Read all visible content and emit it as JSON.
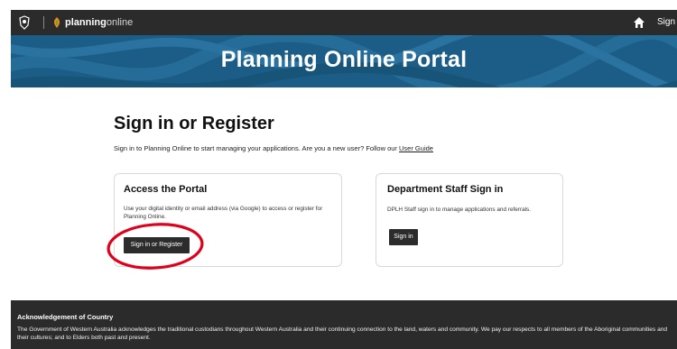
{
  "topbar": {
    "brand_bold": "planning",
    "brand_light": "online",
    "signin_link": "Sign i",
    "icons": [
      "crest-icon",
      "planning-logo-icon",
      "home-icon"
    ]
  },
  "hero": {
    "title": "Planning Online Portal",
    "background": "#1b5d86"
  },
  "main": {
    "title": "Sign in or Register",
    "intro": "Sign in to Planning Online to start managing your applications. Are you a new user? Follow our ",
    "user_guide_link": "User Guide"
  },
  "cards": [
    {
      "title": "Access the Portal",
      "description": "Use your digital identity or email address (via Google) to access or register for Planning Online.",
      "button_label": "Sign in or Register"
    },
    {
      "title": "Department Staff Sign in",
      "description": "DPLH Staff sign in to manage applications and referrals.",
      "button_label": "Sign in"
    }
  ],
  "annotation_color": "#e0001b",
  "footer": {
    "heading": "Acknowledgement of Country",
    "text": "The Government of Western Australia acknowledges the traditional custodians throughout Western Australia and their continuing connection to the land, waters and community. We pay our respects to all members of the Aboriginal communities and their cultures; and to Elders both past and present."
  }
}
